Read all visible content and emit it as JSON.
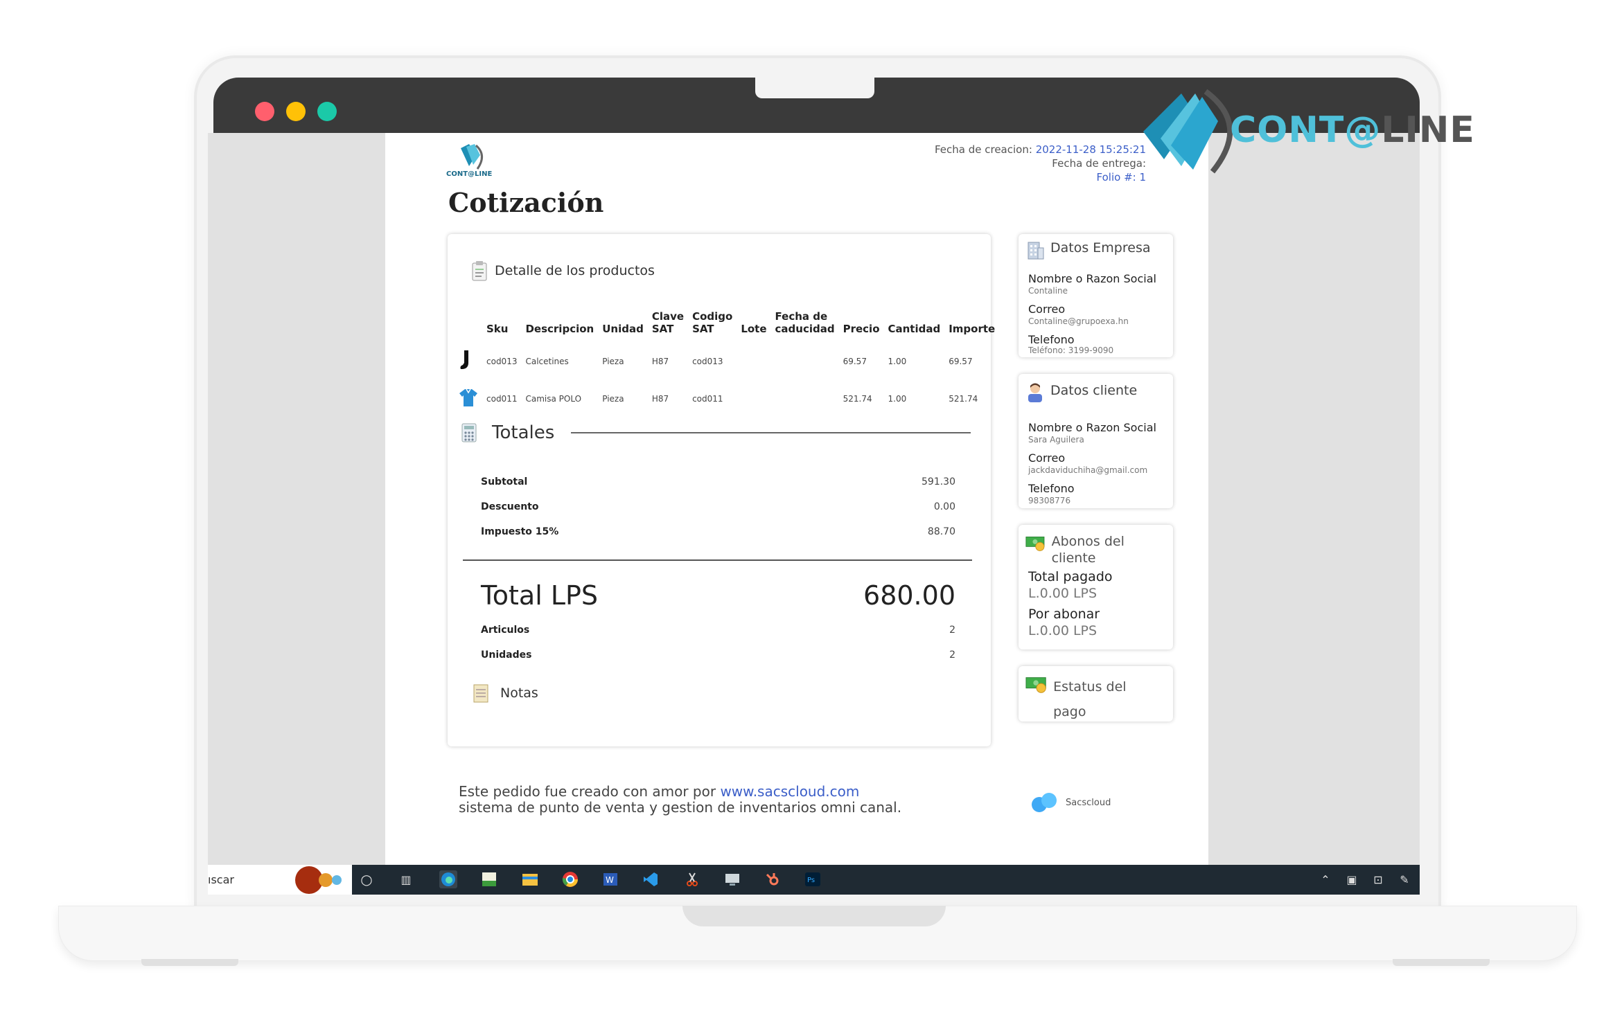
{
  "brand": {
    "name_part1": "CONT@",
    "name_part2": "LINE"
  },
  "document": {
    "logo_text": "CONT@LINE",
    "title": "Cotización",
    "meta": {
      "creation_label": "Fecha de creacion:",
      "creation_value": "2022-11-28 15:25:21",
      "delivery_label": "Fecha de entrega:",
      "folio": "Folio #: 1"
    },
    "products": {
      "section_title": "Detalle de los productos",
      "headers": [
        "Sku",
        "Descripcion",
        "Unidad",
        "Clave SAT",
        "Codigo SAT",
        "Lote",
        "Fecha de caducidad",
        "Precio",
        "Cantidad",
        "Importe"
      ],
      "rows": [
        {
          "sku": "cod013",
          "descripcion": "Calcetines",
          "unidad": "Pieza",
          "clave_sat": "H87",
          "codigo_sat": "cod013",
          "lote": "",
          "fecha": "",
          "precio": "69.57",
          "cantidad": "1.00",
          "importe": "69.57"
        },
        {
          "sku": "cod011",
          "descripcion": "Camisa POLO",
          "unidad": "Pieza",
          "clave_sat": "H87",
          "codigo_sat": "cod011",
          "lote": "",
          "fecha": "",
          "precio": "521.74",
          "cantidad": "1.00",
          "importe": "521.74"
        }
      ]
    },
    "totals": {
      "title": "Totales",
      "subtotal_label": "Subtotal",
      "subtotal": "591.30",
      "descuento_label": "Descuento",
      "descuento": "0.00",
      "impuesto_label": "Impuesto 15%",
      "impuesto": "88.70",
      "total_label": "Total LPS",
      "total": "680.00",
      "articulos_label": "Articulos",
      "articulos": "2",
      "unidades_label": "Unidades",
      "unidades": "2",
      "notas_label": "Notas"
    },
    "empresa": {
      "title": "Datos Empresa",
      "nombre_label": "Nombre o Razon Social",
      "nombre": "Contaline",
      "correo_label": "Correo",
      "correo": "Contaline@grupoexa.hn",
      "telefono_label": "Telefono",
      "telefono": "Teléfono: 3199-9090"
    },
    "cliente": {
      "title": "Datos cliente",
      "nombre_label": "Nombre o Razon Social",
      "nombre": "Sara Aguilera",
      "correo_label": "Correo",
      "correo": "jackdaviduchiha@gmail.com",
      "telefono_label": "Telefono",
      "telefono": "98308776"
    },
    "abonos": {
      "title": "Abonos del cliente",
      "pagado_label": "Total pagado",
      "pagado": "L.0.00 LPS",
      "abonar_label": "Por abonar",
      "abonar": "L.0.00 LPS"
    },
    "estatus": {
      "title": "Estatus del pago"
    },
    "footer": {
      "line1_prefix": "Este pedido fue creado con amor por",
      "link": "www.sacscloud.com",
      "line2": "sistema de punto de venta y gestion de inventarios omni canal.",
      "sacs_brand": "Sacscloud"
    }
  },
  "taskbar": {
    "search_text": "ıscar"
  },
  "colors": {
    "accent": "#3b5ec8",
    "brand_cyan": "#4fc0d9",
    "taskbar": "#1f2a33",
    "traffic_red": "#ff5f6d",
    "traffic_yellow": "#ffc107",
    "traffic_green": "#1bc9a8"
  }
}
